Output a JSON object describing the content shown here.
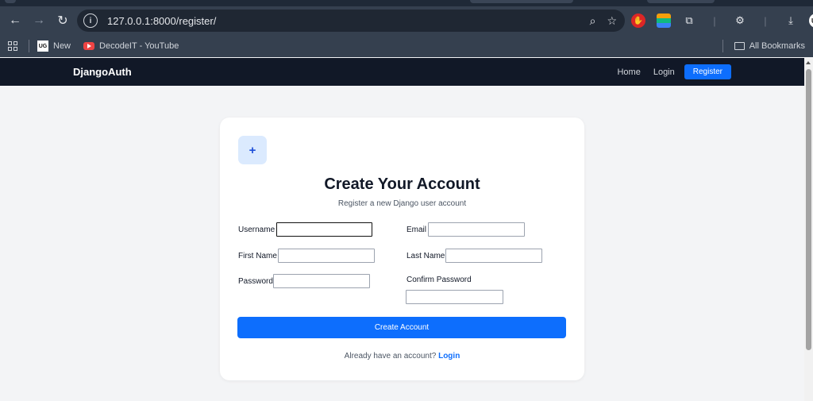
{
  "browser": {
    "url": "127.0.0.1:8000/register/",
    "bookmarks": [
      {
        "label": "New"
      },
      {
        "label": "DecodeIT - YouTube"
      }
    ],
    "all_bookmarks_label": "All Bookmarks",
    "profile_initials": "UG",
    "bookmark_ug_icon_text": "UG"
  },
  "navbar": {
    "brand": "DjangoAuth",
    "links": {
      "home": "Home",
      "login": "Login",
      "register": "Register"
    }
  },
  "form": {
    "icon_glyph": "+",
    "title": "Create Your Account",
    "subtitle": "Register a new Django user account",
    "fields": {
      "username": {
        "label": "Username",
        "value": ""
      },
      "email": {
        "label": "Email",
        "value": ""
      },
      "first_name": {
        "label": "First Name",
        "value": ""
      },
      "last_name": {
        "label": "Last Name",
        "value": ""
      },
      "password": {
        "label": "Password",
        "value": ""
      },
      "confirm_password": {
        "label": "Confirm Password",
        "value": ""
      }
    },
    "submit_label": "Create Account",
    "footer_text": "Already have an account?",
    "footer_link": "Login"
  },
  "colors": {
    "navbar_bg": "#111827",
    "primary": "#0d6efd",
    "page_bg": "#f3f4f6"
  }
}
